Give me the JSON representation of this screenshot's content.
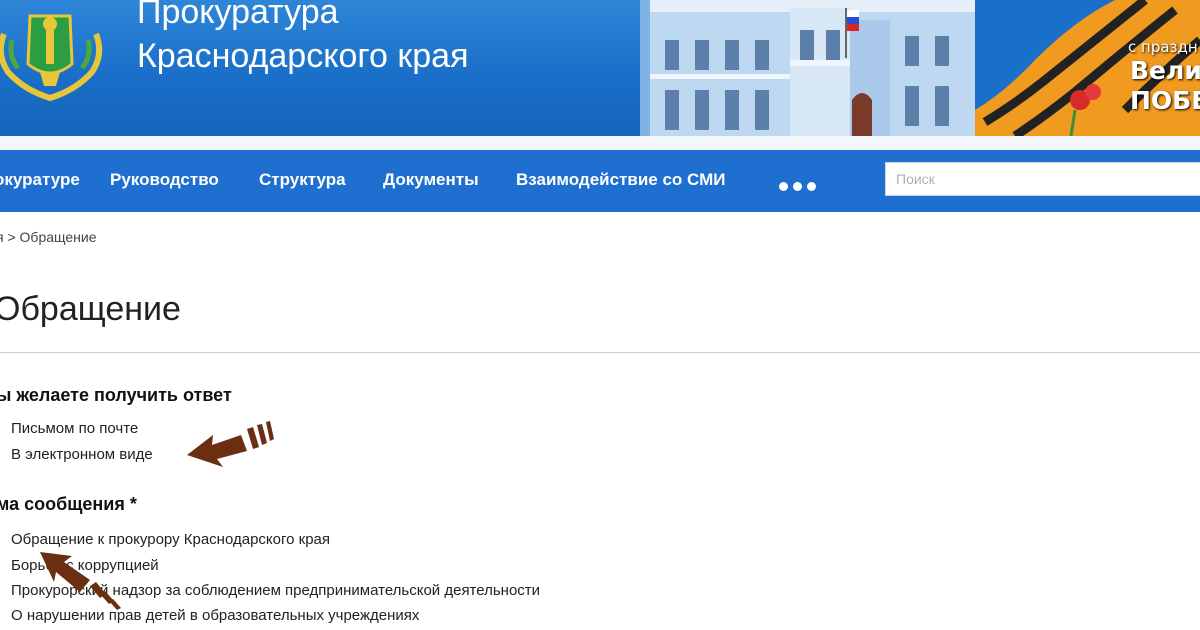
{
  "header": {
    "title_line1": "Прокуратура",
    "title_line2": "Краснодарского края",
    "victory": {
      "line1": "с праздн",
      "line2": "Вели",
      "line3": "ПОБЕ"
    }
  },
  "nav": {
    "items": [
      {
        "label": "окуратуре"
      },
      {
        "label": "Руководство"
      },
      {
        "label": "Структура"
      },
      {
        "label": "Документы"
      },
      {
        "label": "Взаимодействие со СМИ"
      }
    ],
    "more_icon": "ellipsis-dots-icon",
    "search_placeholder": "Поиск"
  },
  "breadcrumb": {
    "text": "я > Обращение"
  },
  "page": {
    "title": "Обращение",
    "reply_section": {
      "label": "ы желаете получить ответ",
      "options": [
        "Письмом по почте",
        "В электронном виде"
      ]
    },
    "topic_section": {
      "label": "ма сообщения *",
      "options": [
        "Обращение к прокурору Краснодарского края",
        "Борьба с коррупцией",
        "Прокурорский надзор за соблюдением предпринимательской деятельности",
        "О нарушении прав детей в образовательных учреждениях"
      ]
    }
  },
  "colors": {
    "header_blue": "#1a6fc8",
    "nav_blue": "#1e6fd0",
    "arrow_brown": "#6b2e10"
  }
}
